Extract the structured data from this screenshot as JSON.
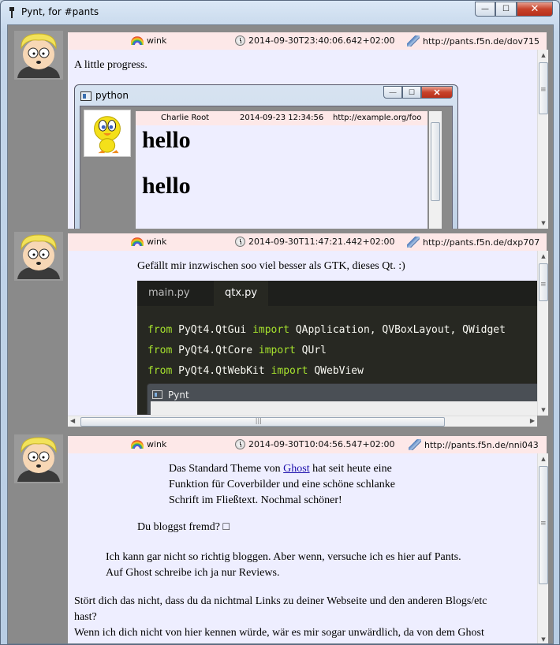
{
  "window": {
    "title": "Pynt, for #pants",
    "buttons": {
      "minimize": "—",
      "maximize": "☐",
      "close": "✕"
    }
  },
  "posts": [
    {
      "user": "wink",
      "timestamp": "2014-09-30T23:40:06.642+02:00",
      "url": "http://pants.f5n.de/dov715",
      "text": "A little progress.",
      "embedded_window": {
        "title": "python",
        "header": {
          "user": "Charlie Root",
          "timestamp": "2014-09-23 12:34:56",
          "url": "http://example.org/foo"
        },
        "lines": [
          "hello",
          "hello"
        ]
      }
    },
    {
      "user": "wink",
      "timestamp": "2014-09-30T11:47:21.442+02:00",
      "url": "http://pants.f5n.de/dxp707",
      "text": "Gefällt mir inzwischen soo viel besser als GTK, dieses Qt. :)",
      "tabs": [
        "main.py",
        "qtx.py"
      ],
      "code": [
        {
          "kw1": "from",
          "mod": " PyQt4.QtGui ",
          "kw2": "import",
          "names": " QApplication, QVBoxLayout, QWidget"
        },
        {
          "kw1": "from",
          "mod": " PyQt4.QtCore ",
          "kw2": "import",
          "names": " QUrl"
        },
        {
          "kw1": "from",
          "mod": " PyQt4.QtWebKit ",
          "kw2": "import",
          "names": " QWebView"
        }
      ],
      "inner_window_title": "Pynt"
    },
    {
      "user": "wink",
      "timestamp": "2014-09-30T10:04:56.547+02:00",
      "url": "http://pants.f5n.de/nni043",
      "quote1_before": "Das Standard Theme von ",
      "quote1_link": "Ghost",
      "quote1_after": " hat seit heute eine",
      "quote1_line2": "Funktion für Coverbilder und eine schöne schlanke",
      "quote1_line3": "Schrift im Fließtext. Nochmal schöner!",
      "quote2": "Du bloggst fremd? □",
      "quote3_line1": "Ich kann gar nicht so richtig bloggen. Aber wenn, versuche ich es hier auf Pants.",
      "quote3_line2": "Auf Ghost schreibe ich ja nur Reviews.",
      "text_line1": "Stört dich das nicht, dass du da nichtmal Links zu deiner Webseite und den anderen Blogs/etc",
      "text_line2": "hast?",
      "text_line3": "Wenn ich dich nicht von hier kennen würde, wär es mir sogar unwärdlich, da von dem Ghost"
    }
  ]
}
